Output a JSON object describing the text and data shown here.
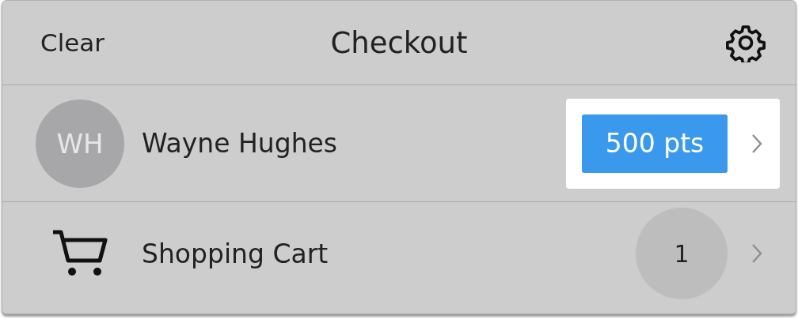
{
  "header": {
    "clear_button": "Clear",
    "title": "Checkout"
  },
  "rows": [
    {
      "kind": "customer",
      "initials": "WH",
      "label": "Wayne Hughes",
      "points": "500 pts",
      "highlighted": true
    },
    {
      "kind": "cart",
      "label": "Shopping Cart",
      "count": "1"
    }
  ]
}
